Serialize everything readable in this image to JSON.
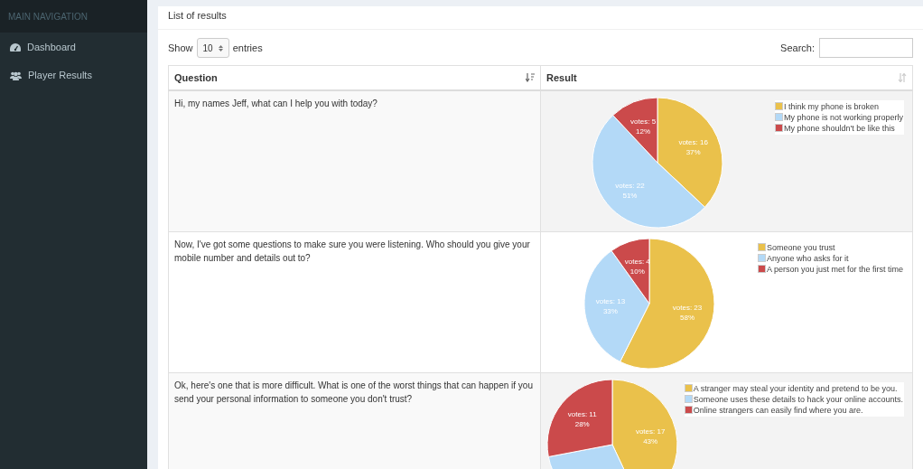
{
  "sidebar": {
    "header": "MAIN NAVIGATION",
    "items": [
      {
        "label": "Dashboard",
        "kind": "dashboard",
        "selected": false
      },
      {
        "label": "Player Results",
        "kind": "players",
        "selected": false
      }
    ]
  },
  "box": {
    "title": "List of results"
  },
  "length": {
    "label_before": "Show",
    "value": "10",
    "label_after": "entries"
  },
  "search": {
    "label": "Search:"
  },
  "table": {
    "columns": [
      {
        "label": "Question",
        "sorted": true
      },
      {
        "label": "Result",
        "sorted": false
      }
    ],
    "rows": [
      {
        "question": "Hi, my names Jeff, what can I help you with today?",
        "chart_data": {
          "type": "pie",
          "categories": [
            "I think my phone is broken",
            "My phone is not working properly",
            "My phone shouldn't be like this"
          ],
          "colors": [
            "#eac14b",
            "#b3d9f7",
            "#cb4a4b"
          ],
          "value_labels": [
            "votes: 16\n37%",
            "votes: 22\n51%",
            "votes: 5\n12%"
          ],
          "values": [
            37,
            51,
            12
          ]
        }
      },
      {
        "question": "Now, I've got some questions to make sure you were listening. Who should you give your mobile number and details out to?",
        "chart_data": {
          "type": "pie",
          "categories": [
            "Someone you trust",
            "Anyone who asks for it",
            "A person you just met for the first time"
          ],
          "colors": [
            "#eac14b",
            "#b3d9f7",
            "#cb4a4b"
          ],
          "value_labels": [
            "votes: 23\n58%",
            "votes: 13\n33%",
            "votes: 4\n10%"
          ],
          "values": [
            58,
            33,
            10
          ]
        }
      },
      {
        "question": "Ok, here's one that is more difficult. What is one of the worst things that can happen if you send your personal information to someone you don't trust?",
        "chart_data": {
          "type": "pie",
          "categories": [
            "A stranger may steal your identity and pretend to be you.",
            "Someone uses these details to hack your online accounts.",
            "Online strangers can easily find where you are."
          ],
          "colors": [
            "#eac14b",
            "#b3d9f7",
            "#cb4a4b"
          ],
          "value_labels": [
            "votes: 17\n43%",
            null,
            "votes: 11\n28%"
          ],
          "values": [
            43,
            29,
            28
          ]
        }
      }
    ]
  }
}
